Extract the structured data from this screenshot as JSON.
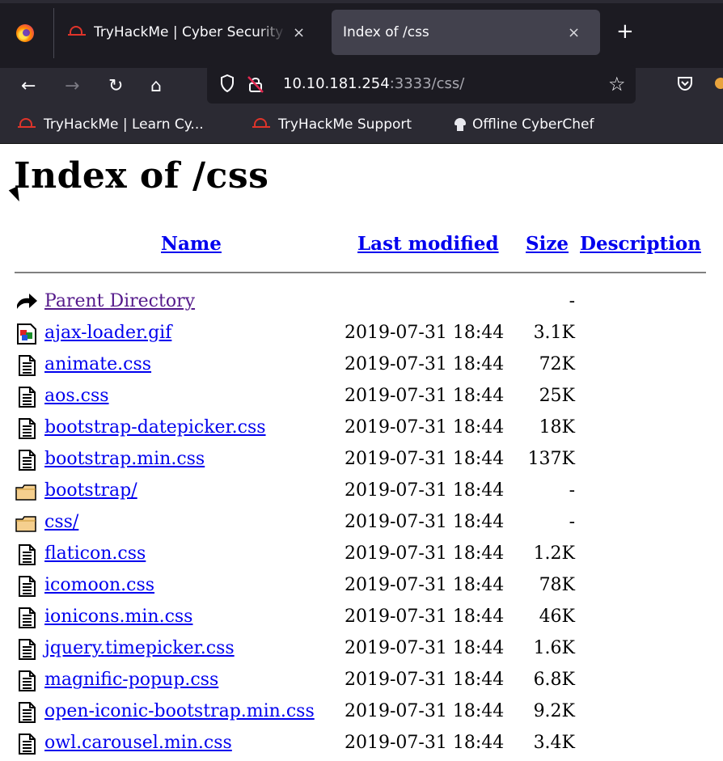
{
  "browser": {
    "tabs": [
      {
        "title": "TryHackMe | Cyber Security Training",
        "close": "×"
      },
      {
        "title": "Index of /css",
        "close": "×"
      }
    ],
    "new_tab": "+",
    "url_host": "10.10.181.254",
    "url_rest": ":3333/css/",
    "bookmarks": [
      {
        "label": "TryHackMe | Learn Cy..."
      },
      {
        "label": "TryHackMe Support"
      },
      {
        "label": "Offline CyberChef"
      }
    ]
  },
  "page": {
    "heading": "Index of /css",
    "columns": {
      "name": "Name",
      "modified": "Last modified",
      "size": "Size",
      "description": "Description"
    },
    "parent": {
      "name": "Parent Directory",
      "size": "-"
    },
    "entries": [
      {
        "name": "ajax-loader.gif",
        "date": "2019-07-31 18:44",
        "size": "3.1K",
        "icon": "image-icon"
      },
      {
        "name": "animate.css",
        "date": "2019-07-31 18:44",
        "size": "72K",
        "icon": "text-file-icon"
      },
      {
        "name": "aos.css",
        "date": "2019-07-31 18:44",
        "size": "25K",
        "icon": "text-file-icon"
      },
      {
        "name": "bootstrap-datepicker.css",
        "date": "2019-07-31 18:44",
        "size": "18K",
        "icon": "text-file-icon"
      },
      {
        "name": "bootstrap.min.css",
        "date": "2019-07-31 18:44",
        "size": "137K",
        "icon": "text-file-icon"
      },
      {
        "name": "bootstrap/",
        "date": "2019-07-31 18:44",
        "size": "-",
        "icon": "folder-icon"
      },
      {
        "name": "css/",
        "date": "2019-07-31 18:44",
        "size": "-",
        "icon": "folder-icon"
      },
      {
        "name": "flaticon.css",
        "date": "2019-07-31 18:44",
        "size": "1.2K",
        "icon": "text-file-icon"
      },
      {
        "name": "icomoon.css",
        "date": "2019-07-31 18:44",
        "size": "78K",
        "icon": "text-file-icon"
      },
      {
        "name": "ionicons.min.css",
        "date": "2019-07-31 18:44",
        "size": "46K",
        "icon": "text-file-icon"
      },
      {
        "name": "jquery.timepicker.css",
        "date": "2019-07-31 18:44",
        "size": "1.6K",
        "icon": "text-file-icon"
      },
      {
        "name": "magnific-popup.css",
        "date": "2019-07-31 18:44",
        "size": "6.8K",
        "icon": "text-file-icon"
      },
      {
        "name": "open-iconic-bootstrap.min.css",
        "date": "2019-07-31 18:44",
        "size": "9.2K",
        "icon": "text-file-icon"
      },
      {
        "name": "owl.carousel.min.css",
        "date": "2019-07-31 18:44",
        "size": "3.4K",
        "icon": "text-file-icon"
      }
    ]
  },
  "colors": {
    "link": "#0000ee",
    "visited": "#551a8b",
    "chrome_dark": "#1c1b22",
    "chrome": "#2b2a33",
    "active_tab": "#42414d"
  }
}
